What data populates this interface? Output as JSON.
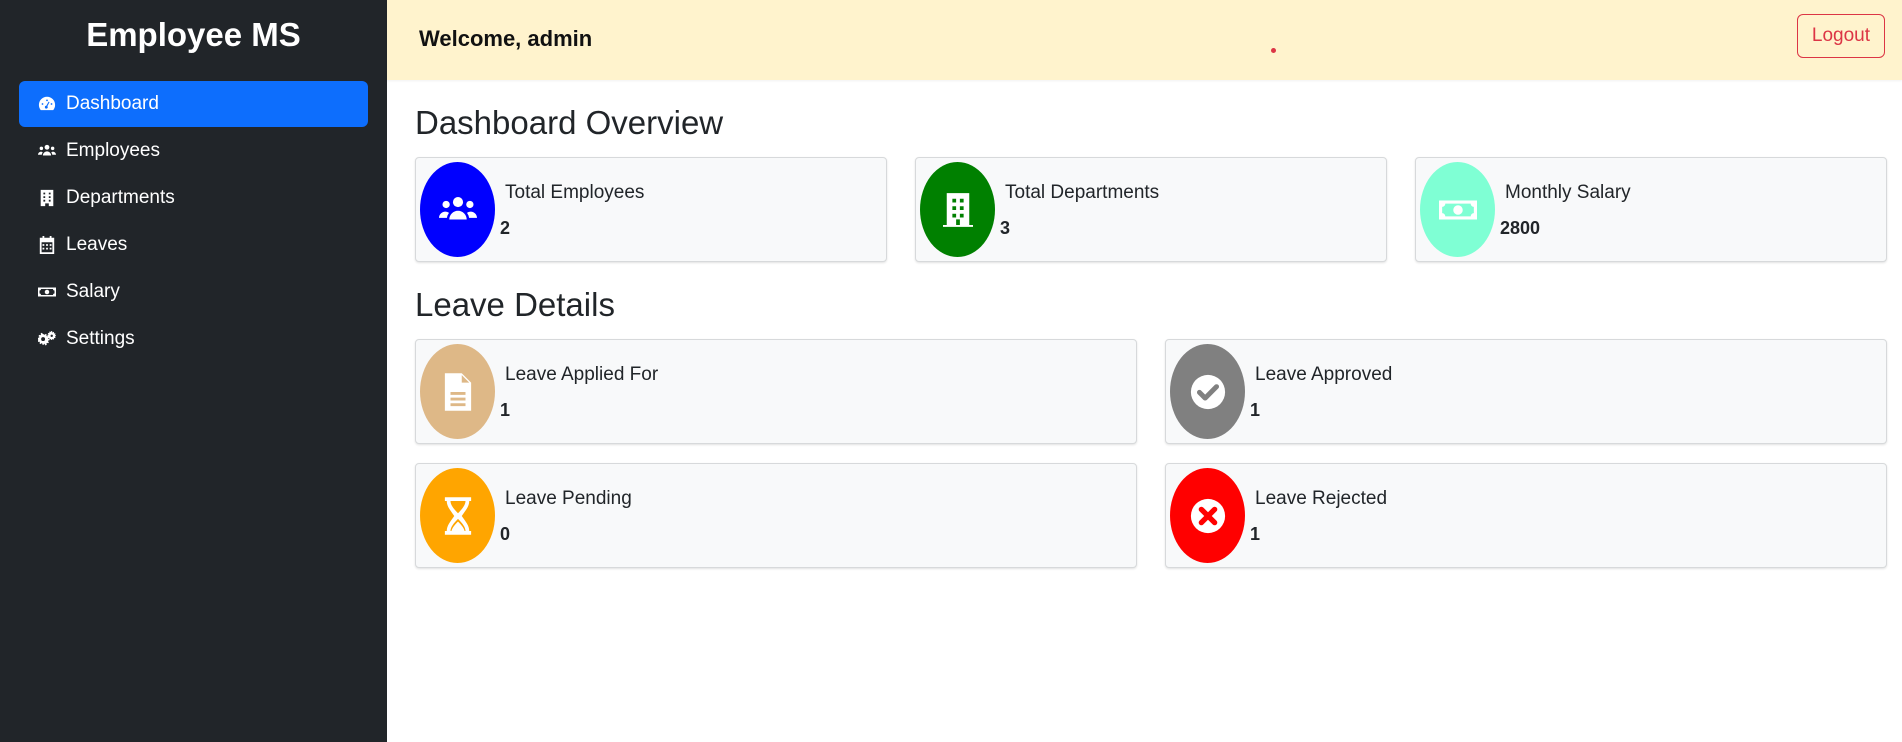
{
  "sidebar": {
    "brand": "Employee MS",
    "items": [
      {
        "label": "Dashboard",
        "icon": "gauge-icon",
        "active": true
      },
      {
        "label": "Employees",
        "icon": "users-icon",
        "active": false
      },
      {
        "label": "Departments",
        "icon": "building-icon",
        "active": false
      },
      {
        "label": "Leaves",
        "icon": "calendar-icon",
        "active": false
      },
      {
        "label": "Salary",
        "icon": "money-bill-icon",
        "active": false
      },
      {
        "label": "Settings",
        "icon": "gears-icon",
        "active": false
      }
    ]
  },
  "header": {
    "welcome": "Welcome, admin",
    "logout_label": "Logout"
  },
  "overview": {
    "title": "Dashboard Overview",
    "cards": [
      {
        "label": "Total Employees",
        "value": "2",
        "icon": "users-icon",
        "color": "#0000ff"
      },
      {
        "label": "Total Departments",
        "value": "3",
        "icon": "building-icon",
        "color": "#008000"
      },
      {
        "label": "Monthly Salary",
        "value": "2800",
        "icon": "money-bill-icon",
        "color": "#7fffd4"
      }
    ]
  },
  "leave": {
    "title": "Leave Details",
    "cards": [
      {
        "label": "Leave Applied For",
        "value": "1",
        "icon": "file-icon",
        "color": "#deb887"
      },
      {
        "label": "Leave Approved",
        "value": "1",
        "icon": "check-circle-icon",
        "color": "#808080"
      },
      {
        "label": "Leave Pending",
        "value": "0",
        "icon": "hourglass-icon",
        "color": "#ffa500"
      },
      {
        "label": "Leave Rejected",
        "value": "1",
        "icon": "times-circle-icon",
        "color": "#ff0000"
      }
    ]
  }
}
